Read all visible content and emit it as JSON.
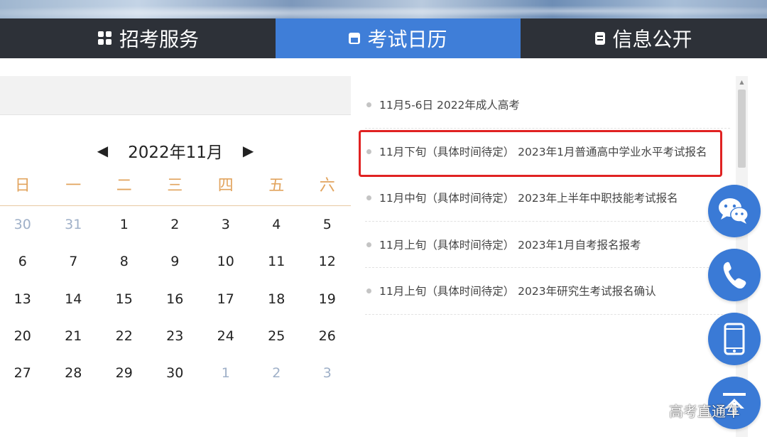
{
  "nav": {
    "tabs": [
      {
        "label": "招考服务",
        "icon": "grid-icon"
      },
      {
        "label": "考试日历",
        "icon": "calendar-icon"
      },
      {
        "label": "信息公开",
        "icon": "document-icon"
      }
    ],
    "active_index": 1,
    "active_color": "#3f7ed8",
    "bg_color": "#2d3138"
  },
  "calendar": {
    "month_label": "2022年11月",
    "prev_arrow": "◀",
    "next_arrow": "▶",
    "weekdays": [
      "日",
      "一",
      "二",
      "三",
      "四",
      "五",
      "六"
    ],
    "days": [
      [
        "30",
        "31",
        "1",
        "2",
        "3",
        "4",
        "5"
      ],
      [
        "6",
        "7",
        "8",
        "9",
        "10",
        "11",
        "12"
      ],
      [
        "13",
        "14",
        "15",
        "16",
        "17",
        "18",
        "19"
      ],
      [
        "20",
        "21",
        "22",
        "23",
        "24",
        "25",
        "26"
      ],
      [
        "27",
        "28",
        "29",
        "30",
        "1",
        "2",
        "3"
      ]
    ],
    "weekday_color": "#e2a45e",
    "muted_color": "#9fb0c8"
  },
  "events": [
    "11月5-6日 2022年成人高考",
    "11月下旬（具体时间待定） 2023年1月普通高中学业水平考试报名",
    "11月中旬（具体时间待定） 2023年上半年中职技能考试报名",
    "11月上旬（具体时间待定） 2023年1月自考报名报考",
    "11月上旬（具体时间待定） 2023年研究生考试报名确认"
  ],
  "highlighted_event_index": 1,
  "highlight_color": "#e02222",
  "float_buttons": [
    "wechat-icon",
    "phone-icon",
    "mobile-icon",
    "back-to-top-icon"
  ],
  "float_color": "#3a7ad6",
  "watermark": "高考直通车"
}
